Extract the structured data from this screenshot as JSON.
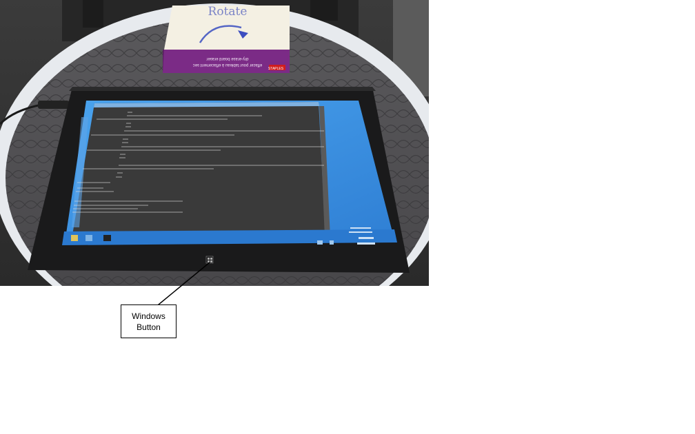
{
  "photo": {
    "box_label": "Rotate",
    "box_product_text": "dry-erase board eraser",
    "box_product_subtext": "effacer pour tableau à effacement sec",
    "box_brand": "STAPLES",
    "taskbar_label": "Windows Button"
  },
  "callout": {
    "line1": "Windows",
    "line2": "Button"
  },
  "colors": {
    "desktop_blue": "#3d8fe0",
    "console_bg": "#3a3a3a",
    "table_gray": "#4b4a4c",
    "table_rim": "#e9ecef"
  }
}
